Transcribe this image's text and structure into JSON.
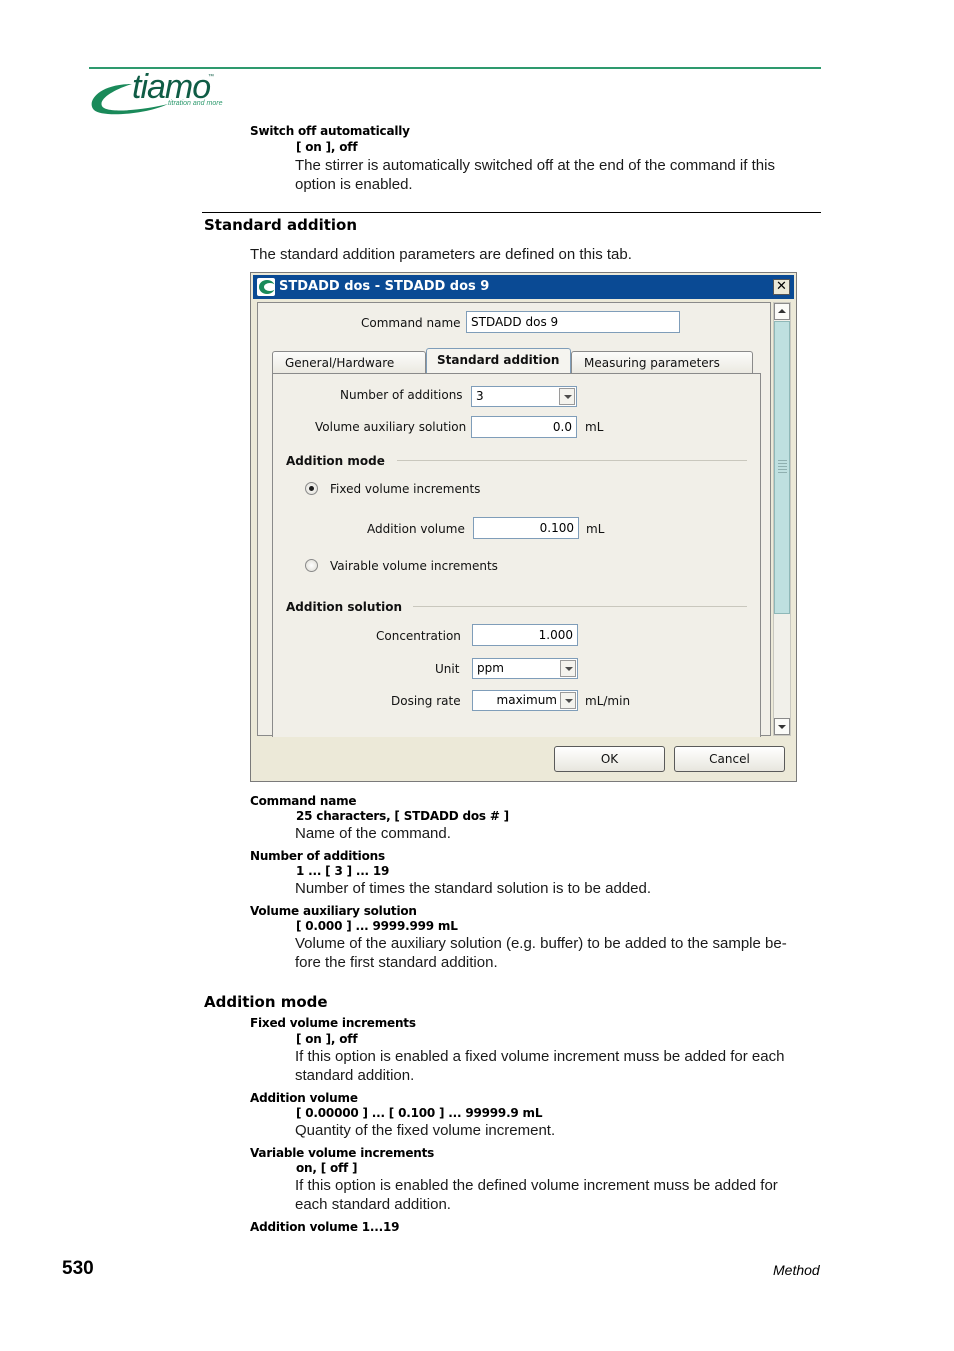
{
  "logo": {
    "word": "tiamo",
    "tm": "™",
    "tagline": "titration and more",
    "color": "#0f5c45",
    "accent": "#2e9a6e"
  },
  "intro_param": {
    "name": "Switch off automatically",
    "range": "[ on ], off",
    "desc": [
      "The stirrer is automatically switched off at the end of the command if this",
      "option is enabled."
    ]
  },
  "section": {
    "title": "Standard addition",
    "desc": "The standard addition parameters are defined on this tab."
  },
  "dialog": {
    "title": "STDADD dos - STDADD dos 9",
    "close_label": "✕",
    "command_name_label": "Command name",
    "command_name_value": "STDADD dos 9",
    "tabs": [
      {
        "label": "General/Hardware",
        "active": false
      },
      {
        "label": "Standard addition",
        "active": true
      },
      {
        "label": "Measuring parameters",
        "active": false
      }
    ],
    "number_of_additions_label": "Number of additions",
    "number_of_additions_value": "3",
    "volume_aux_label": "Volume auxiliary solution",
    "volume_aux_value": "0.0",
    "volume_aux_unit": "mL",
    "addition_mode_title": "Addition mode",
    "fixed_label": "Fixed volume increments",
    "fixed_selected": true,
    "addition_volume_label": "Addition volume",
    "addition_volume_value": "0.100",
    "addition_volume_unit": "mL",
    "variable_label": "Vairable volume increments",
    "variable_selected": false,
    "addition_solution_title": "Addition solution",
    "concentration_label": "Concentration",
    "concentration_value": "1.000",
    "unit_label": "Unit",
    "unit_value": "ppm",
    "dosing_rate_label": "Dosing rate",
    "dosing_rate_value": "maximum",
    "dosing_rate_unit": "mL/min",
    "ok_label": "OK",
    "cancel_label": "Cancel"
  },
  "params": [
    {
      "name": "Command name",
      "range": "25 characters, [ STDADD dos # ]",
      "desc": [
        "Name of the command."
      ]
    },
    {
      "name": "Number of additions",
      "range": "1 ... [ 3 ] ... 19",
      "desc": [
        "Number of times the standard solution is to be added."
      ]
    },
    {
      "name": "Volume auxiliary solution",
      "range": "[ 0.000 ] ... 9999.999 mL",
      "desc": [
        "Volume of the auxiliary solution (e.g. buffer) to be added to the sample be-",
        "fore the first standard addition."
      ]
    }
  ],
  "addition_mode": {
    "title": "Addition mode",
    "params": [
      {
        "name": "Fixed volume increments",
        "range": "[ on ], off",
        "desc": [
          "If this option is enabled a fixed volume increment muss be added for each",
          "standard addition."
        ]
      },
      {
        "name": "Addition volume",
        "range": "[ 0.00000 ] ... [ 0.100 ] ... 99999.9 mL",
        "desc": [
          "Quantity of the fixed volume increment."
        ]
      },
      {
        "name": "Variable volume increments",
        "range": "on, [ off ]",
        "desc": [
          "If this option is enabled the defined volume increment muss be added for",
          "each standard addition."
        ]
      },
      {
        "name": "Addition volume 1...19"
      }
    ]
  },
  "footer": {
    "page_number": "530",
    "section": "Method"
  }
}
